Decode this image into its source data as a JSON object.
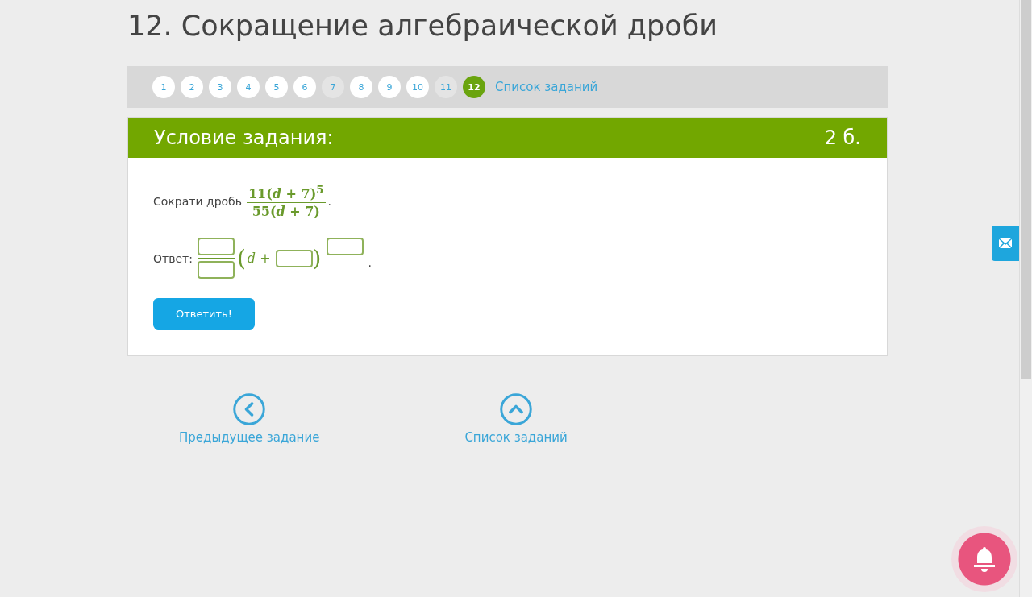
{
  "title": "12. Сокращение алгебраической дроби",
  "task_nav": {
    "items": [
      {
        "label": "1",
        "solved": false,
        "selected": false
      },
      {
        "label": "2",
        "solved": false,
        "selected": false
      },
      {
        "label": "3",
        "solved": false,
        "selected": false
      },
      {
        "label": "4",
        "solved": false,
        "selected": false
      },
      {
        "label": "5",
        "solved": false,
        "selected": false
      },
      {
        "label": "6",
        "solved": false,
        "selected": false
      },
      {
        "label": "7",
        "solved": true,
        "selected": false
      },
      {
        "label": "8",
        "solved": false,
        "selected": false
      },
      {
        "label": "9",
        "solved": false,
        "selected": false
      },
      {
        "label": "10",
        "solved": false,
        "selected": false
      },
      {
        "label": "11",
        "solved": true,
        "selected": false
      },
      {
        "label": "12",
        "solved": false,
        "selected": true
      }
    ],
    "list_link": "Список заданий"
  },
  "task": {
    "header": "Условие задания:",
    "points": "2 б.",
    "prompt": "Сократи дробь",
    "numerator": "11(*d* + 7)$^{5}$",
    "denominator": "55(*d* + 7)",
    "prompt_end": ".",
    "answer": {
      "label": "Ответ:",
      "open": "(",
      "inner": "*d* +",
      "close": ")",
      "end": "."
    },
    "submit": "Ответить!"
  },
  "bottom_nav": [
    {
      "kind": "prev",
      "label": "Предыдущее задание"
    },
    {
      "kind": "list",
      "label": "Список заданий"
    }
  ]
}
